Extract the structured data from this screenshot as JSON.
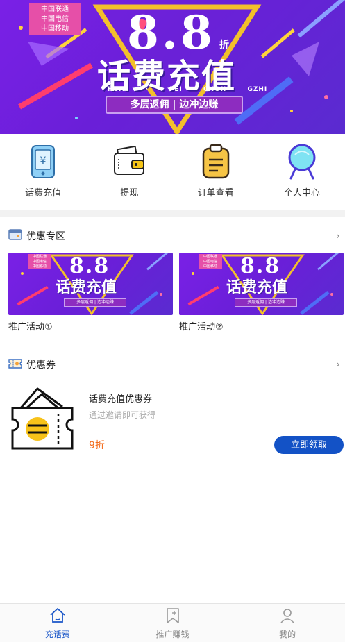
{
  "banner": {
    "carriers": [
      "中国联通",
      "中国电信",
      "中国移动"
    ],
    "discount_number": "8.8",
    "discount_unit": "折",
    "title": "话费充值",
    "pinyin": "HUA · FEI CHON GZHI",
    "slogan": "多层返佣 | 边冲边赚"
  },
  "quick_nav": [
    {
      "label": "话费充值",
      "icon": "phone-recharge-icon"
    },
    {
      "label": "提现",
      "icon": "wallet-icon"
    },
    {
      "label": "订单查看",
      "icon": "clipboard-icon"
    },
    {
      "label": "个人中心",
      "icon": "user-icon"
    }
  ],
  "promo_section": {
    "title": "优惠专区",
    "cards": [
      {
        "label": "推广活动①"
      },
      {
        "label": "推广活动②"
      }
    ]
  },
  "coupon_section": {
    "title": "优惠券",
    "coupon": {
      "name": "话费充值优惠券",
      "desc": "通过邀请即可获得",
      "discount": "9折",
      "button": "立即领取"
    }
  },
  "tabbar": [
    {
      "label": "充话费",
      "icon": "home-icon",
      "active": true
    },
    {
      "label": "推广赚钱",
      "icon": "bookmark-icon",
      "active": false
    },
    {
      "label": "我的",
      "icon": "profile-icon",
      "active": false
    }
  ],
  "colors": {
    "banner_purple": "#7a20e6",
    "accent_blue": "#1352c6",
    "discount_orange": "#f36a1a",
    "tag_pink": "#e64fa8"
  }
}
